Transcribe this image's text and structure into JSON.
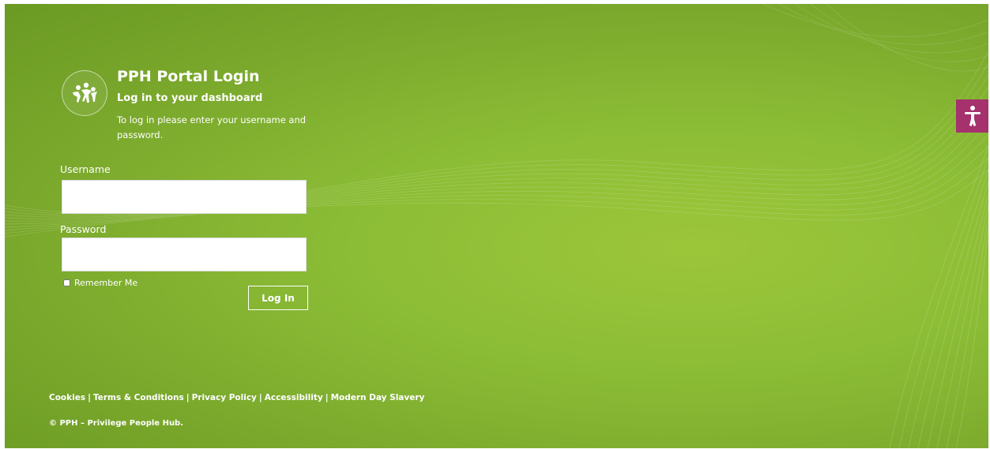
{
  "header": {
    "title": "PPH Portal Login",
    "subtitle": "Log in to your dashboard",
    "intro": "To log in please enter your username and password."
  },
  "form": {
    "username_label": "Username",
    "username_value": "",
    "password_label": "Password",
    "password_value": "",
    "remember_label": "Remember Me",
    "remember_checked": false,
    "submit_label": "Log In"
  },
  "footer": {
    "links": [
      "Cookies",
      "Terms & Conditions",
      "Privacy Policy",
      "Accessibility",
      "Modern Day Slavery"
    ],
    "separator": "|",
    "copyright": "© PPH – Privilege People Hub."
  },
  "icons": {
    "logo": "people-logo-icon",
    "accessibility": "accessibility-icon"
  },
  "colors": {
    "background_green": "#8cbd36",
    "accessibility_button": "#a5316d",
    "text": "#ffffff"
  }
}
